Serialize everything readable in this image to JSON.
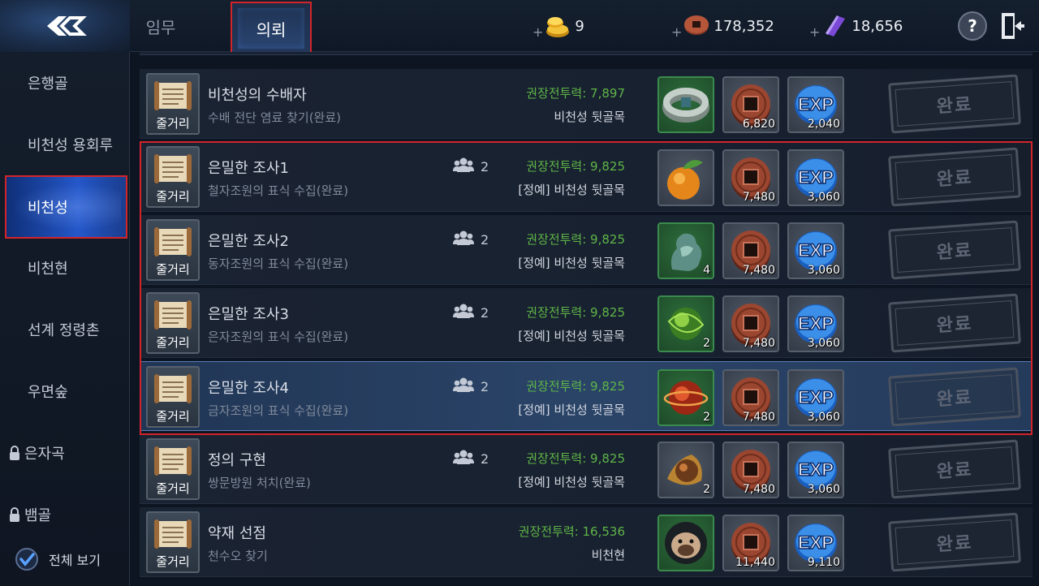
{
  "topbar": {
    "tabs": [
      "임무",
      "의뢰"
    ],
    "active_tab": "의뢰",
    "currencies": [
      {
        "icon": "gold-ingot-icon",
        "plus": "+",
        "value": "9"
      },
      {
        "icon": "copper-coin-icon",
        "plus": "+",
        "value": "178,352"
      },
      {
        "icon": "purple-crystal-icon",
        "plus": "+",
        "value": "18,656"
      }
    ],
    "help_label": "?",
    "exit_icon": "exit-door-icon"
  },
  "sidebar": {
    "items": [
      {
        "label": "은행골",
        "locked": false
      },
      {
        "label": "비천성 용회루",
        "locked": false
      },
      {
        "label": "비천성",
        "locked": false,
        "active": true
      },
      {
        "label": "비천현",
        "locked": false
      },
      {
        "label": "선계 정령촌",
        "locked": false
      },
      {
        "label": "우면숲",
        "locked": false
      },
      {
        "label": "은자곡",
        "locked": true
      },
      {
        "label": "뱀골",
        "locked": true
      }
    ],
    "view_all": {
      "label": "전체 보기",
      "checked": true
    }
  },
  "quests": [
    {
      "title": "비천성의 수배자",
      "subtitle": "수배 전단 염료 찾기(완료)",
      "party": "",
      "power": "권장전투력: 7,897",
      "location": "비천성 뒷골목",
      "rewards": [
        {
          "icon": "bracelet-icon",
          "style": "green",
          "count": ""
        },
        {
          "icon": "copper-coin-icon",
          "style": "gray",
          "count": "6,820"
        },
        {
          "icon": "exp-icon",
          "style": "gray",
          "count": "2,040"
        }
      ],
      "button": "완료",
      "story_label": "줄거리"
    },
    {
      "title": "은밀한 조사1",
      "subtitle": "철자조원의 표식 수집(완료)",
      "party": "2",
      "power": "권장전투력: 9,825",
      "location": "[정예] 비천성 뒷골목",
      "rewards": [
        {
          "icon": "orange-fruit-icon",
          "style": "gray",
          "count": ""
        },
        {
          "icon": "copper-coin-icon",
          "style": "gray",
          "count": "7,480"
        },
        {
          "icon": "exp-icon",
          "style": "gray",
          "count": "3,060"
        }
      ],
      "button": "완료",
      "story_label": "줄거리"
    },
    {
      "title": "은밀한 조사2",
      "subtitle": "동자조원의 표식 수집(완료)",
      "party": "2",
      "power": "권장전투력: 9,825",
      "location": "[정예] 비천성 뒷골목",
      "rewards": [
        {
          "icon": "jade-statue-icon",
          "style": "green",
          "count": "4"
        },
        {
          "icon": "copper-coin-icon",
          "style": "gray",
          "count": "7,480"
        },
        {
          "icon": "exp-icon",
          "style": "gray",
          "count": "3,060"
        }
      ],
      "button": "완료",
      "story_label": "줄거리"
    },
    {
      "title": "은밀한 조사3",
      "subtitle": "은자조원의 표식 수집(완료)",
      "party": "2",
      "power": "권장전투력: 9,825",
      "location": "[정예] 비천성 뒷골목",
      "rewards": [
        {
          "icon": "green-orb-icon",
          "style": "green",
          "count": "2"
        },
        {
          "icon": "copper-coin-icon",
          "style": "gray",
          "count": "7,480"
        },
        {
          "icon": "exp-icon",
          "style": "gray",
          "count": "3,060"
        }
      ],
      "button": "완료",
      "story_label": "줄거리"
    },
    {
      "title": "은밀한 조사4",
      "subtitle": "금자조원의 표식 수집(완료)",
      "party": "2",
      "power": "권장전투력: 9,825",
      "location": "[정예] 비천성 뒷골목",
      "rewards": [
        {
          "icon": "red-orb-icon",
          "style": "green",
          "count": "2"
        },
        {
          "icon": "copper-coin-icon",
          "style": "gray",
          "count": "7,480"
        },
        {
          "icon": "exp-icon",
          "style": "gray",
          "count": "3,060"
        }
      ],
      "button": "완료",
      "story_label": "줄거리",
      "highlight": true
    },
    {
      "title": "정의 구현",
      "subtitle": "쌍문방원 처치(완료)",
      "party": "2",
      "power": "권장전투력: 9,825",
      "location": "[정예] 비천성 뒷골목",
      "rewards": [
        {
          "icon": "amber-orb-icon",
          "style": "gray",
          "count": "2"
        },
        {
          "icon": "copper-coin-icon",
          "style": "gray",
          "count": "7,480"
        },
        {
          "icon": "exp-icon",
          "style": "gray",
          "count": "3,060"
        }
      ],
      "button": "완료",
      "story_label": "줄거리"
    },
    {
      "title": "약재 선점",
      "subtitle": "천수오 찾기",
      "party": "",
      "power": "권장전투력: 16,536",
      "location": "비천현",
      "rewards": [
        {
          "icon": "bulldog-portrait-icon",
          "style": "green",
          "count": ""
        },
        {
          "icon": "copper-coin-icon",
          "style": "gray",
          "count": "11,440"
        },
        {
          "icon": "exp-icon",
          "style": "gray",
          "count": "9,110"
        }
      ],
      "button": "완료",
      "story_label": "줄거리"
    }
  ],
  "colors": {
    "accent_red": "#d3242a",
    "power_green": "#5fb547",
    "active_blue": "#2457c9"
  }
}
